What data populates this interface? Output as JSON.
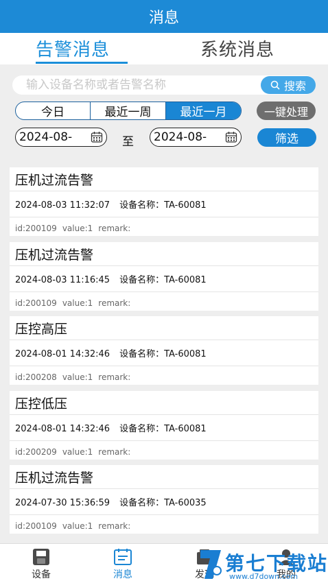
{
  "header": {
    "title": "消息"
  },
  "tabs": [
    {
      "label": "告警消息"
    },
    {
      "label": "系统消息"
    }
  ],
  "search": {
    "placeholder": "输入设备名称或者告警名称",
    "button_label": "搜索"
  },
  "period": {
    "options": [
      "今日",
      "最近一周",
      "最近一月"
    ],
    "selected": "最近一月"
  },
  "quick_action": "一键处理",
  "date_range": {
    "start": "2024-08-",
    "separator": "至",
    "end": "2024-08-",
    "filter_label": "筛选"
  },
  "device_label": "设备名称：",
  "alarms": [
    {
      "title": "压机过流告警",
      "time": "2024-08-03 11:32:07",
      "device": "TA-60081",
      "id": "id:200109",
      "value": "value:1",
      "remark": "remark:"
    },
    {
      "title": "压机过流告警",
      "time": "2024-08-03 11:16:45",
      "device": "TA-60081",
      "id": "id:200109",
      "value": "value:1",
      "remark": "remark:"
    },
    {
      "title": "压控高压",
      "time": "2024-08-01 14:32:46",
      "device": "TA-60081",
      "id": "id:200208",
      "value": "value:1",
      "remark": "remark:"
    },
    {
      "title": "压控低压",
      "time": "2024-08-01 14:32:46",
      "device": "TA-60081",
      "id": "id:200209",
      "value": "value:1",
      "remark": "remark:"
    },
    {
      "title": "压机过流告警",
      "time": "2024-07-30 15:36:59",
      "device": "TA-60035",
      "id": "id:200109",
      "value": "value:1",
      "remark": "remark:"
    }
  ],
  "bottom_nav": [
    {
      "label": "设备",
      "icon": "device-icon"
    },
    {
      "label": "消息",
      "icon": "message-icon"
    },
    {
      "label": "发现",
      "icon": "discover-icon"
    },
    {
      "label": "我的",
      "icon": "profile-icon"
    }
  ],
  "watermark": {
    "text": "第七下载站",
    "url": "www.d7down.com"
  },
  "colors": {
    "primary": "#1d8ad6",
    "accent": "#1a86d4",
    "muted_button": "#6e6e6e"
  }
}
